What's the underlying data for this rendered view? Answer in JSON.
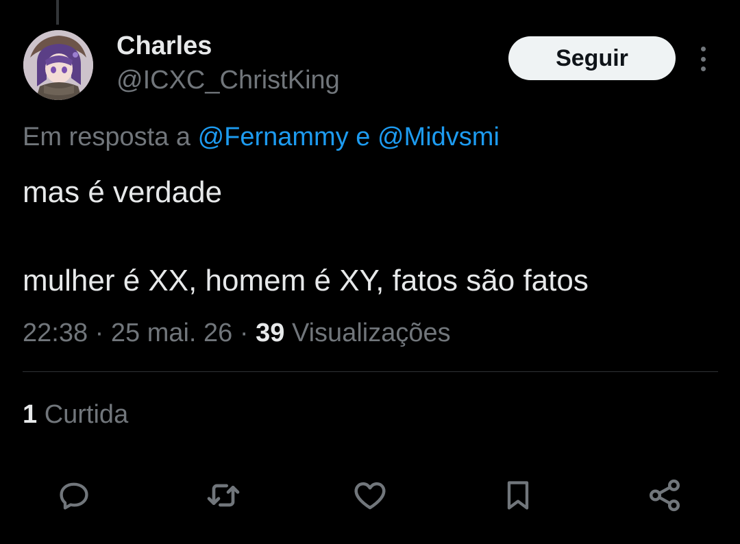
{
  "author": {
    "display_name": "Charles",
    "handle": "@ICXC_ChristKing"
  },
  "header": {
    "follow_label": "Seguir",
    "more_icon": "more-vertical-icon"
  },
  "reply_context": {
    "prefix": "Em resposta a",
    "mention_1": "@Fernammy",
    "connector": "e",
    "mention_2": "@Midvsmi"
  },
  "tweet": {
    "line_1": "mas é verdade",
    "line_2": "mulher é XX, homem é XY, fatos são fatos"
  },
  "meta": {
    "time": "22:38",
    "separator": "·",
    "date": "25 mai. 26",
    "views_count": "39",
    "views_label": "Visualizações"
  },
  "engagement": {
    "likes_count": "1",
    "likes_label": "Curtida"
  },
  "actions": [
    "reply-icon",
    "retweet-icon",
    "like-icon",
    "bookmark-icon",
    "share-icon"
  ],
  "colors": {
    "background": "#000000",
    "text_primary": "#e7e9ea",
    "text_secondary": "#71767b",
    "link": "#1d9bf0",
    "divider": "#2f3336",
    "button_bg": "#eff3f4",
    "button_text": "#0f1419"
  }
}
